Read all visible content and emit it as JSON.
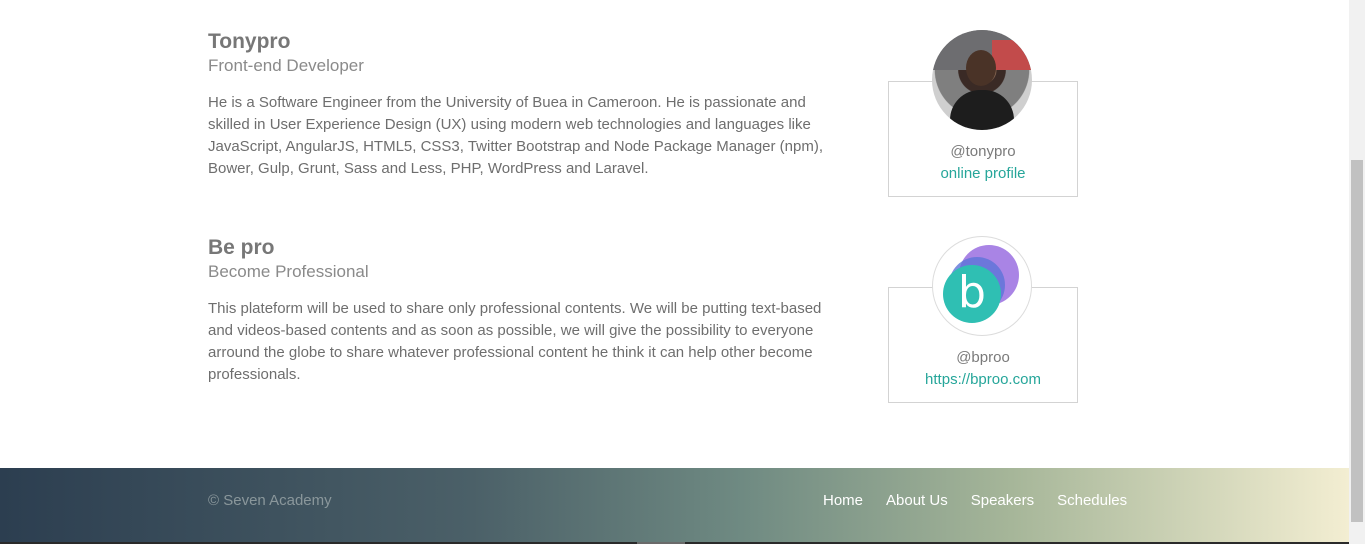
{
  "speakers": [
    {
      "name": "Tonypro",
      "role": "Front-end Developer",
      "bio": "He is a Software Engineer from the University of Buea in Cameroon. He is passionate and skilled in User Experience Design (UX) using modern web technologies and languages like JavaScript, AngularJS, HTML5, CSS3, Twitter Bootstrap and Node Package Manager (npm), Bower, Gulp, Grunt, Sass and Less, PHP, WordPress and Laravel.",
      "handle": "@tonypro",
      "link": "online profile"
    },
    {
      "name": "Be pro",
      "role": "Become Professional",
      "bio": "This plateform will be used to share only professional contents. We will be putting text-based and videos-based contents and as soon as possible, we will give the possibility to everyone arround the globe to share whatever professional content he think it can help other become professionals.",
      "handle": "@bproo",
      "link": "https://bproo.com",
      "logo_letter": "b"
    }
  ],
  "footer": {
    "copyright": "© Seven Academy",
    "nav": [
      "Home",
      "About Us",
      "Speakers",
      "Schedules"
    ]
  },
  "colors": {
    "link": "#26a69a",
    "footer_gradient_start": "#2c3e50",
    "footer_gradient_end": "#f3eed2"
  }
}
